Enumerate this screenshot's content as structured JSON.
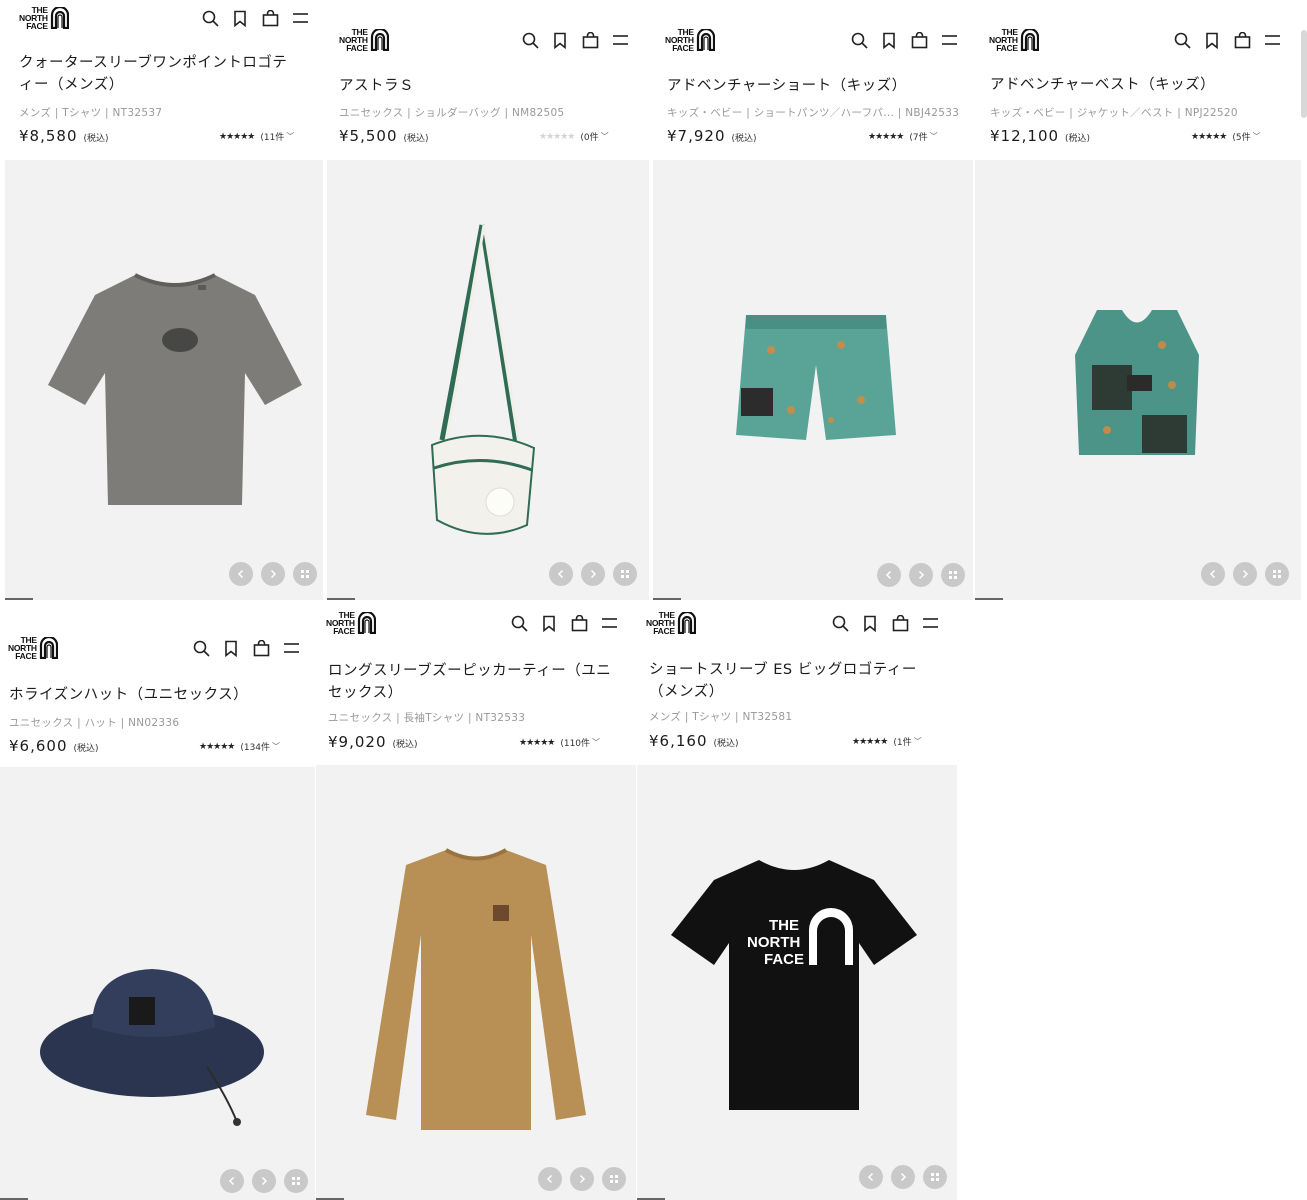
{
  "logo": {
    "line1": "THE",
    "line2": "NORTH",
    "line3": "FACE"
  },
  "tax_label": "(税込)",
  "products": [
    {
      "title": "クォータースリーブワンポイントロゴティー（メンズ）",
      "meta": "メンズ | Tシャツ | NT32537",
      "price": "¥8,580",
      "stars": "★★★★★",
      "rating_count": "(11件",
      "chevron": "﹀",
      "image": "gray-tshirt"
    },
    {
      "title": "アストラＳ",
      "meta": "ユニセックス | ショルダーバッグ | NM82505",
      "price": "¥5,500",
      "stars": "★★★★★",
      "rating_count": "(0件",
      "chevron": "﹀",
      "image": "white-shoulder-bag"
    },
    {
      "title": "アドベンチャーショート（キッズ）",
      "meta": "キッズ・ベビー | ショートパンツ／ハーフパ... | NBJ42533",
      "price": "¥7,920",
      "stars": "★★★★★",
      "rating_count": "(7件",
      "chevron": "﹀",
      "image": "teal-print-shorts"
    },
    {
      "title": "アドベンチャーベスト（キッズ）",
      "meta": "キッズ・ベビー | ジャケット／ベスト | NPJ22520",
      "price": "¥12,100",
      "stars": "★★★★★",
      "rating_count": "(5件",
      "chevron": "﹀",
      "image": "teal-print-vest"
    },
    {
      "title": "ホライズンハット（ユニセックス）",
      "meta": "ユニセックス | ハット | NN02336",
      "price": "¥6,600",
      "stars": "★★★★★",
      "rating_count": "(134件",
      "chevron": "﹀",
      "image": "navy-bucket-hat"
    },
    {
      "title": "ロングスリーブズーピッカーティー（ユニセックス）",
      "meta": "ユニセックス | 長袖Tシャツ | NT32533",
      "price": "¥9,020",
      "stars": "★★★★★",
      "rating_count": "(110件",
      "chevron": "﹀",
      "image": "khaki-long-sleeve-tee"
    },
    {
      "title": "ショートスリーブ ES ビッグロゴティー（メンズ）",
      "meta": "メンズ | Tシャツ | NT32581",
      "price": "¥6,160",
      "stars": "★★★★★",
      "rating_count": "(1件",
      "chevron": "﹀",
      "image": "black-logo-tshirt"
    }
  ],
  "icons": {
    "search": "search-icon",
    "bookmark": "bookmark-icon",
    "cart": "cart-icon",
    "menu": "menu-icon",
    "prev": "chevron-left-icon",
    "next": "chevron-right-icon",
    "grid": "grid-icon"
  },
  "colors": {
    "image_bg": "#f2f2f2",
    "nav_button": "#c9c9c9",
    "star": "#222222",
    "star_empty": "#d4d4d4",
    "meta_text": "#999999"
  }
}
